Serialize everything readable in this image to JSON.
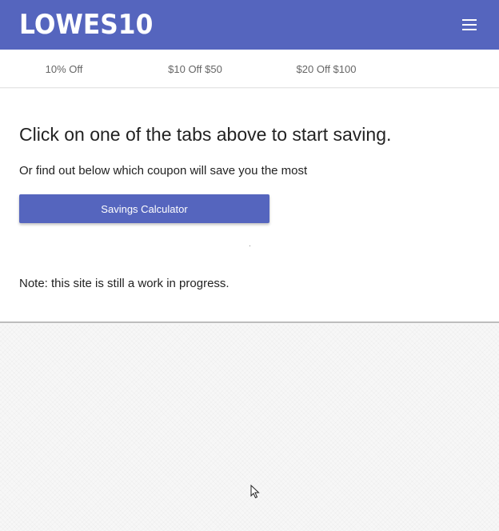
{
  "header": {
    "logo_text": "LOWES10",
    "menu_icon": "hamburger-menu-icon",
    "background_color": "#5565be"
  },
  "tabs": [
    {
      "label": "10% Off"
    },
    {
      "label": "$10 Off $50"
    },
    {
      "label": "$20 Off $100"
    }
  ],
  "main": {
    "headline": "Click on one of the tabs above to start saving.",
    "subtext": "Or find out below which coupon will save you the most",
    "calculator_button_label": "Savings Calculator",
    "note": "Note: this site is still a work in progress."
  },
  "cursor": {
    "icon": "mouse-pointer-icon"
  }
}
